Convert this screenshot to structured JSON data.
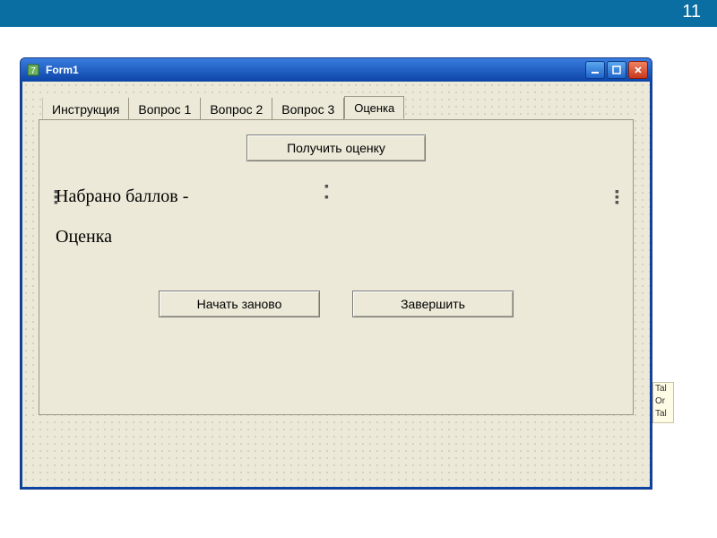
{
  "page_number": "11",
  "window": {
    "title": "Form1",
    "buttons": {
      "minimize": "_",
      "maximize": "□",
      "close": "×"
    }
  },
  "tabs": [
    {
      "label": "Инструкция"
    },
    {
      "label": "Вопрос 1"
    },
    {
      "label": "Вопрос 2"
    },
    {
      "label": "Вопрос 3"
    },
    {
      "label": "Оценка",
      "active": true
    }
  ],
  "panel": {
    "get_grade_button": "Получить оценку",
    "score_label": "Набрано баллов  -",
    "grade_label": "Оценка",
    "restart_button": "Начать заново",
    "finish_button": "Завершить"
  },
  "side_snippet": {
    "line1": "Tal",
    "line2": "Or",
    "line3": "Tal"
  }
}
